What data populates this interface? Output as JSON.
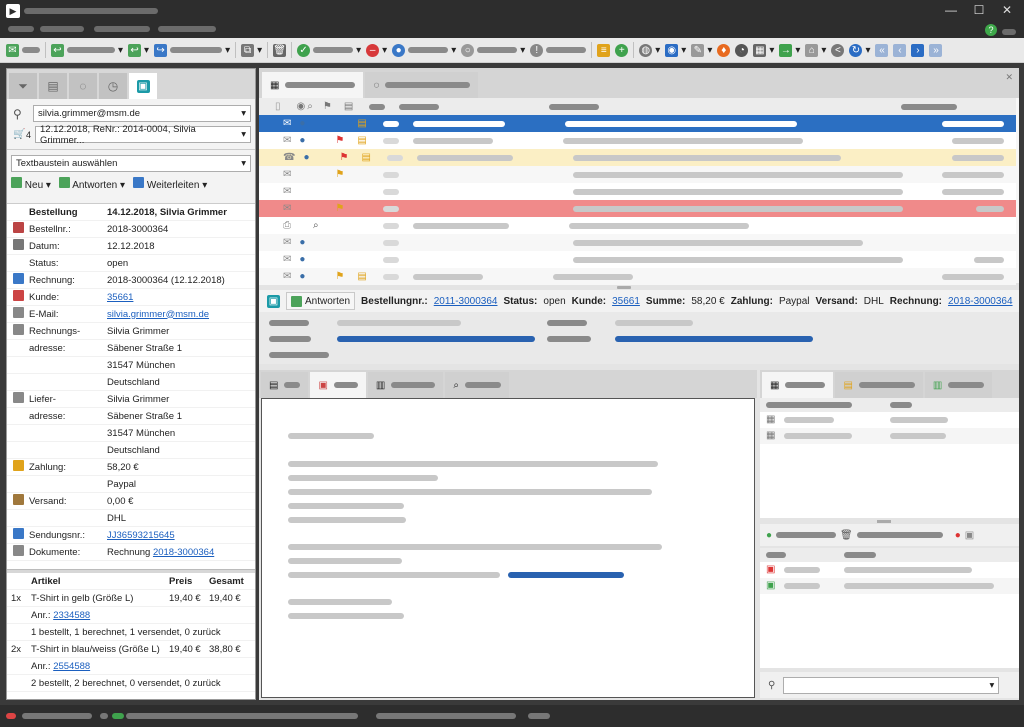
{
  "left": {
    "email_select": "silvia.grimmer@msm.de",
    "order_count": "4",
    "order_select": "12.12.2018, ReNr.: 2014-0004, Silvia Grimmer...",
    "textblock_select": "Textbaustein auswählen",
    "actions": {
      "new": "Neu",
      "reply": "Antworten",
      "forward": "Weiterleiten"
    },
    "details": {
      "heading_label": "Bestellung",
      "heading_value": "14.12.2018, Silvia Grimmer",
      "rows": [
        {
          "label": "Bestellnr.:",
          "value": "2018-3000364"
        },
        {
          "label": "Datum:",
          "value": "12.12.2018"
        },
        {
          "label": "Status:",
          "value": "open"
        },
        {
          "label": "Rechnung:",
          "value": "2018-3000364 (12.12.2018)"
        },
        {
          "label": "Kunde:",
          "value": "35661"
        },
        {
          "label": "E-Mail:",
          "value": "silvia.grimmer@msm.de"
        },
        {
          "label": "Rechnungs-",
          "value": "Silvia Grimmer"
        },
        {
          "label": "adresse:",
          "value": "Säbener Straße 1"
        },
        {
          "label": "",
          "value": "31547 München"
        },
        {
          "label": "",
          "value": "Deutschland"
        },
        {
          "label": "Liefer-",
          "value": "Silvia Grimmer"
        },
        {
          "label": "adresse:",
          "value": "Säbener Straße 1"
        },
        {
          "label": "",
          "value": "31547 München"
        },
        {
          "label": "",
          "value": "Deutschland"
        },
        {
          "label": "Zahlung:",
          "value": "58,20 €"
        },
        {
          "label": "",
          "value": "Paypal"
        },
        {
          "label": "Versand:",
          "value": "0,00 €"
        },
        {
          "label": "",
          "value": "DHL"
        },
        {
          "label": "Sendungsnr.:",
          "value": "JJ36593215645"
        },
        {
          "label": "Dokumente:",
          "value": "Rechnung ",
          "link": "2018-3000364"
        }
      ]
    },
    "articles": {
      "headers": {
        "article": "Artikel",
        "price": "Preis",
        "total": "Gesamt"
      },
      "items": [
        {
          "qty": "1x",
          "name": "T-Shirt in gelb (Größe L)",
          "price": "19,40 €",
          "total": "19,40 €",
          "anr_label": "Anr.:",
          "anr": "2334588",
          "status": "1 bestellt, 1 berechnet, 1 versendet, 0 zurück"
        },
        {
          "qty": "2x",
          "name": "T-Shirt in blau/weiss (Größe L)",
          "price": "19,40 €",
          "total": "38,80 €",
          "anr_label": "Anr.:",
          "anr": "2554588",
          "status": "2 bestellt, 2 berechnet, 0 versendet, 0 zurück"
        }
      ]
    }
  },
  "infobar": {
    "reply": "Antworten",
    "order_label": "Bestellungnr.:",
    "order_value": "2011-3000364",
    "status_label": "Status:",
    "status_value": "open",
    "customer_label": "Kunde:",
    "customer_value": "35661",
    "sum_label": "Summe:",
    "sum_value": "58,20 €",
    "payment_label": "Zahlung:",
    "payment_value": "Paypal",
    "shipping_label": "Versand:",
    "shipping_value": "DHL",
    "invoice_label": "Rechnung:",
    "invoice_value": "2018-3000364"
  },
  "colors": {
    "accent": "#1b9aa7",
    "selected_row": "#2b6fc2",
    "highlight_yellow": "#fbefc5",
    "highlight_red": "#f08a8a"
  }
}
